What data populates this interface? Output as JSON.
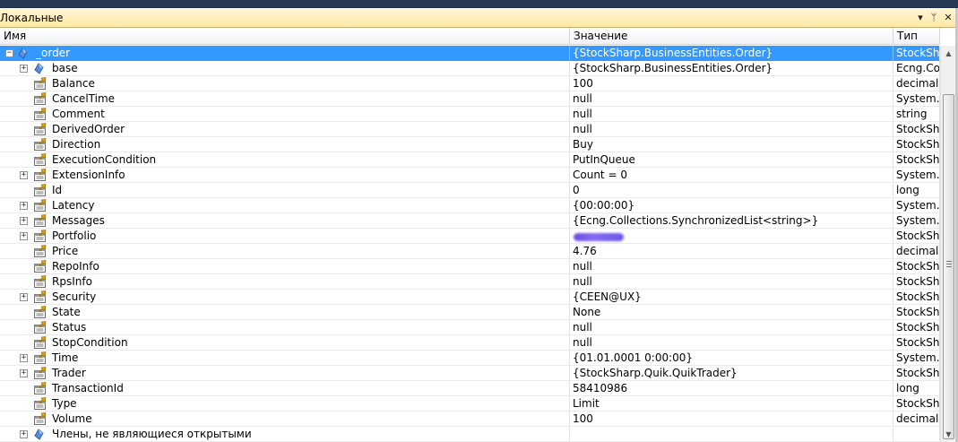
{
  "window": {
    "title": "Локальные",
    "dropdown_glyph": "▾",
    "pin_glyph": "ᛘ",
    "close_glyph": "✕"
  },
  "columns": {
    "name": "Имя",
    "value": "Значение",
    "type": "Тип"
  },
  "rows": [
    {
      "name": "_order",
      "value": "{StockSharp.BusinessEntities.Order}",
      "type": "StockSha",
      "level": 0,
      "expander": "⊟",
      "icon": "object-icon",
      "selected": true
    },
    {
      "name": "base",
      "value": "{StockSharp.BusinessEntities.Order}",
      "type": "Ecng.Co",
      "level": 1,
      "expander": "⊞",
      "icon": "object-icon"
    },
    {
      "name": "Balance",
      "value": "100",
      "type": "decimal",
      "level": 1,
      "icon": "property-icon"
    },
    {
      "name": "CancelTime",
      "value": "null",
      "type": "System.D",
      "level": 1,
      "icon": "property-icon"
    },
    {
      "name": "Comment",
      "value": "null",
      "type": "string",
      "level": 1,
      "icon": "property-icon"
    },
    {
      "name": "DerivedOrder",
      "value": "null",
      "type": "StockSha",
      "level": 1,
      "icon": "property-icon"
    },
    {
      "name": "Direction",
      "value": "Buy",
      "type": "StockSha",
      "level": 1,
      "icon": "property-icon"
    },
    {
      "name": "ExecutionCondition",
      "value": "PutInQueue",
      "type": "StockSha",
      "level": 1,
      "icon": "property-icon"
    },
    {
      "name": "ExtensionInfo",
      "value": "Count = 0",
      "type": "System.C",
      "level": 1,
      "expander": "⊞",
      "icon": "property-icon"
    },
    {
      "name": "Id",
      "value": "0",
      "type": "long",
      "level": 1,
      "icon": "property-icon"
    },
    {
      "name": "Latency",
      "value": "{00:00:00}",
      "type": "System.T",
      "level": 1,
      "expander": "⊞",
      "icon": "property-icon"
    },
    {
      "name": "Messages",
      "value": "{Ecng.Collections.SynchronizedList<string>}",
      "type": "System.C",
      "level": 1,
      "expander": "⊞",
      "icon": "property-icon"
    },
    {
      "name": "Portfolio",
      "value": "",
      "type": "StockSha",
      "level": 1,
      "expander": "⊞",
      "icon": "property-icon",
      "redacted": true
    },
    {
      "name": "Price",
      "value": "4.76",
      "type": "decimal",
      "level": 1,
      "icon": "property-icon"
    },
    {
      "name": "RepoInfo",
      "value": "null",
      "type": "StockSha",
      "level": 1,
      "icon": "property-icon"
    },
    {
      "name": "RpsInfo",
      "value": "null",
      "type": "StockSha",
      "level": 1,
      "icon": "property-icon"
    },
    {
      "name": "Security",
      "value": "{CEEN@UX}",
      "type": "StockSha",
      "level": 1,
      "expander": "⊞",
      "icon": "property-icon"
    },
    {
      "name": "State",
      "value": "None",
      "type": "StockSha",
      "level": 1,
      "icon": "property-icon"
    },
    {
      "name": "Status",
      "value": "null",
      "type": "StockSha",
      "level": 1,
      "icon": "property-icon"
    },
    {
      "name": "StopCondition",
      "value": "null",
      "type": "StockSha",
      "level": 1,
      "icon": "property-icon"
    },
    {
      "name": "Time",
      "value": "{01.01.0001 0:00:00}",
      "type": "System.D",
      "level": 1,
      "expander": "⊞",
      "icon": "property-icon"
    },
    {
      "name": "Trader",
      "value": "{StockSharp.Quik.QuikTrader}",
      "type": "StockSha",
      "level": 1,
      "expander": "⊞",
      "icon": "property-icon"
    },
    {
      "name": "TransactionId",
      "value": "58410986",
      "type": "long",
      "level": 1,
      "icon": "property-icon"
    },
    {
      "name": "Type",
      "value": "Limit",
      "type": "StockSha",
      "level": 1,
      "icon": "property-icon"
    },
    {
      "name": "Volume",
      "value": "100",
      "type": "decimal",
      "level": 1,
      "icon": "property-icon"
    },
    {
      "name": "Члены, не являющиеся открытыми",
      "value": "",
      "type": "",
      "level": 1,
      "expander": "⊞",
      "icon": "object-icon"
    }
  ],
  "scrollbar": {
    "up": "▲",
    "down": "▼"
  },
  "colors": {
    "selection": "#3399ff",
    "title_gradient_top": "#fff6d4",
    "title_gradient_bottom": "#ffe8a6",
    "top_strip": "#293955"
  }
}
